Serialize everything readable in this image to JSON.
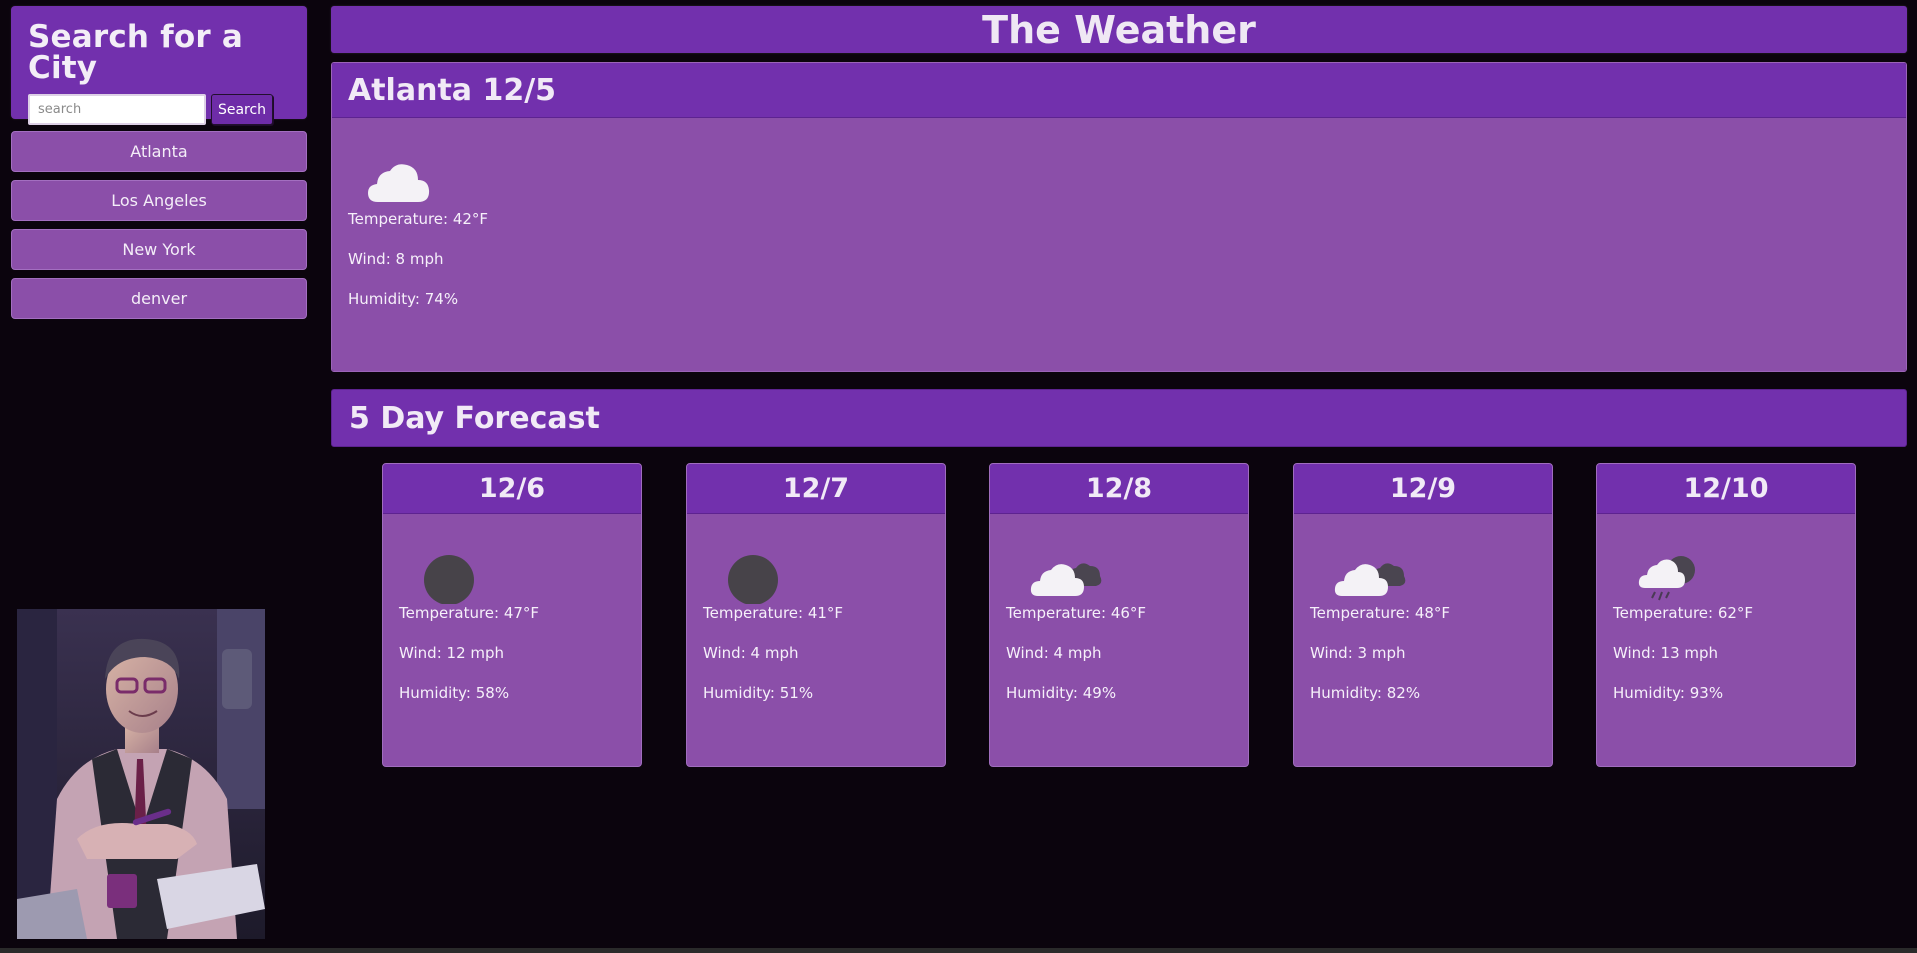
{
  "sidebar": {
    "search_title": "Search for a City",
    "search_placeholder": "search",
    "search_value": "",
    "search_button": "Search",
    "history": [
      "Atlanta",
      "Los Angeles",
      "New York",
      "denver"
    ]
  },
  "main": {
    "title": "The Weather",
    "current": {
      "heading": "Atlanta 12/5",
      "icon": "cloud-icon",
      "temperature": "Temperature: 42°F",
      "wind": "Wind: 8 mph",
      "humidity": "Humidity: 74%"
    },
    "forecast_heading": "5 Day Forecast",
    "forecast": [
      {
        "date": "12/6",
        "icon": "clear-night-icon",
        "temperature": "Temperature: 47°F",
        "wind": "Wind: 12 mph",
        "humidity": "Humidity: 58%"
      },
      {
        "date": "12/7",
        "icon": "clear-night-icon",
        "temperature": "Temperature: 41°F",
        "wind": "Wind: 4 mph",
        "humidity": "Humidity: 51%"
      },
      {
        "date": "12/8",
        "icon": "broken-clouds-icon",
        "temperature": "Temperature: 46°F",
        "wind": "Wind: 4 mph",
        "humidity": "Humidity: 49%"
      },
      {
        "date": "12/9",
        "icon": "broken-clouds-icon",
        "temperature": "Temperature: 48°F",
        "wind": "Wind: 3 mph",
        "humidity": "Humidity: 82%"
      },
      {
        "date": "12/10",
        "icon": "rain-icon",
        "temperature": "Temperature: 62°F",
        "wind": "Wind: 13 mph",
        "humidity": "Humidity: 93%"
      }
    ]
  },
  "colors": {
    "background": "#0b040d",
    "header_purple": "#7230ad",
    "card_purple": "#8b4fa9"
  }
}
